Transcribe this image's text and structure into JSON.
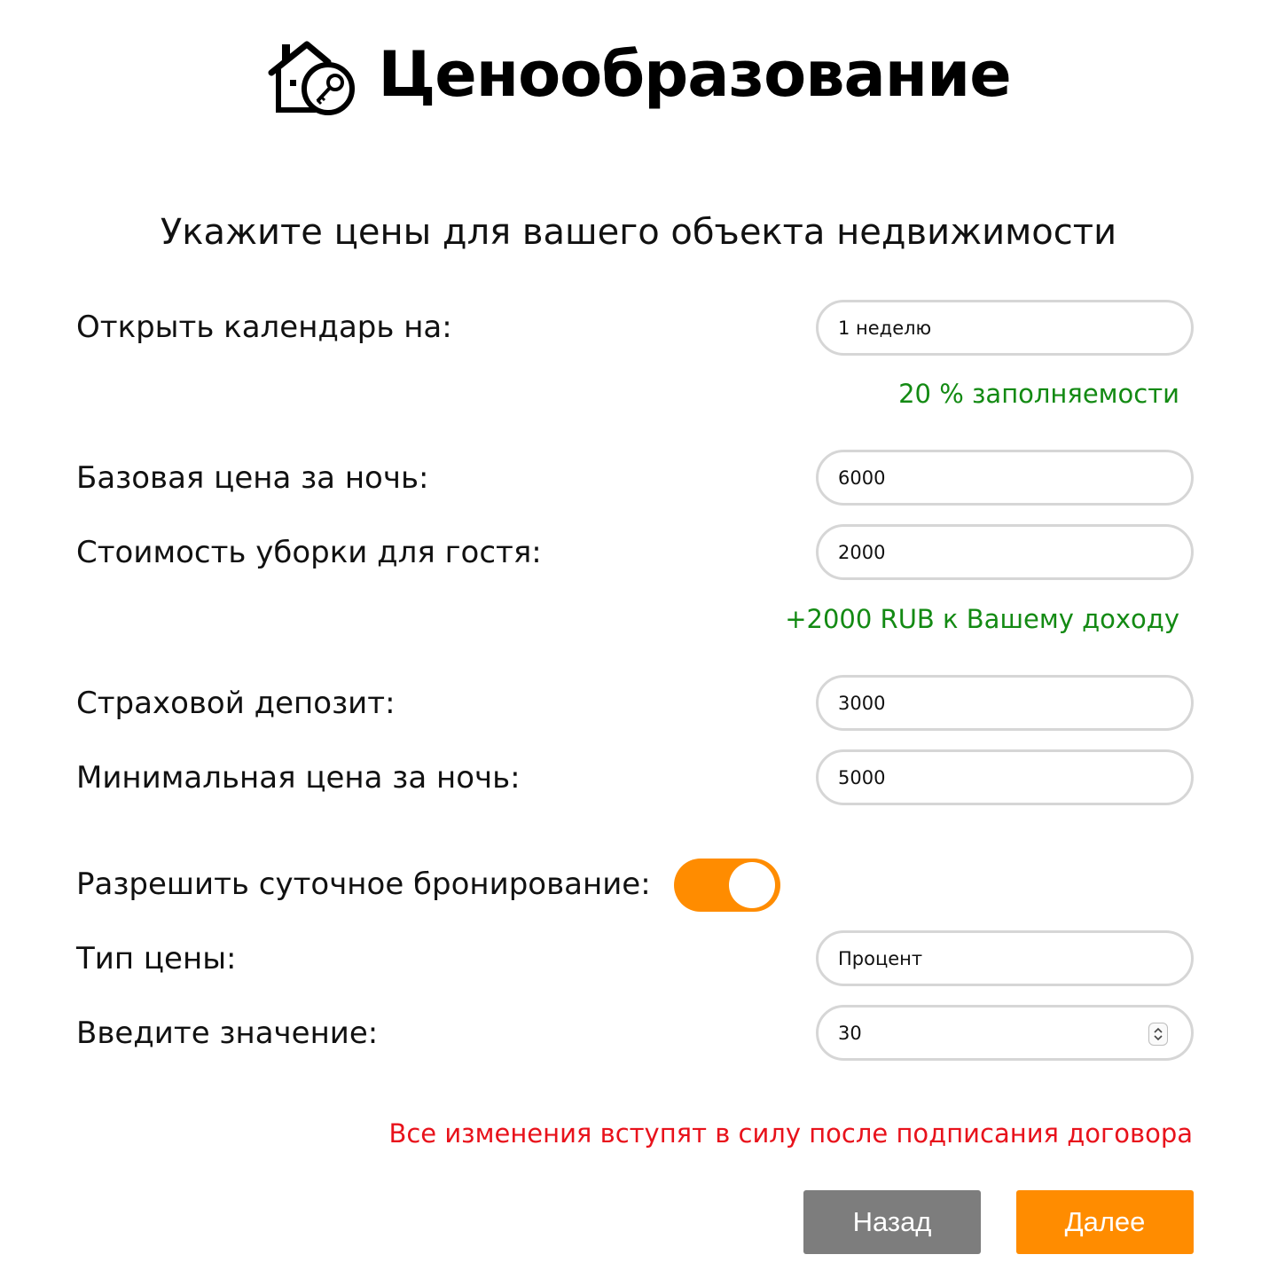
{
  "header": {
    "logo_icon": "house-key-icon",
    "title": "Ценообразование"
  },
  "subtitle": "Укажите цены для вашего объекта недвижимости",
  "form": {
    "calendar": {
      "label": "Открыть календарь на:",
      "value": "1 неделю",
      "note": "20 % заполняемости"
    },
    "base_price": {
      "label": "Базовая цена за ночь:",
      "value": "6000"
    },
    "cleaning": {
      "label": "Стоимость уборки для гостя:",
      "value": "2000",
      "note": "+2000 RUB к Вашему доходу"
    },
    "deposit": {
      "label": "Страховой депозит:",
      "value": "3000"
    },
    "min_price": {
      "label": "Минимальная цена за ночь:",
      "value": "5000"
    },
    "daily_booking": {
      "label": "Разрешить суточное бронирование:",
      "enabled": true
    },
    "price_type": {
      "label": "Тип цены:",
      "value": "Процент"
    },
    "amount": {
      "label": "Введите значение:",
      "value": "30"
    }
  },
  "warning": "Все изменения вступят в силу после подписания договора",
  "buttons": {
    "back": "Назад",
    "next": "Далее"
  },
  "colors": {
    "accent": "#ff8c00",
    "success": "#138a13",
    "warning": "#e8121b",
    "secondary_button": "#7d7d7d",
    "field_border": "#d6d6d6"
  }
}
